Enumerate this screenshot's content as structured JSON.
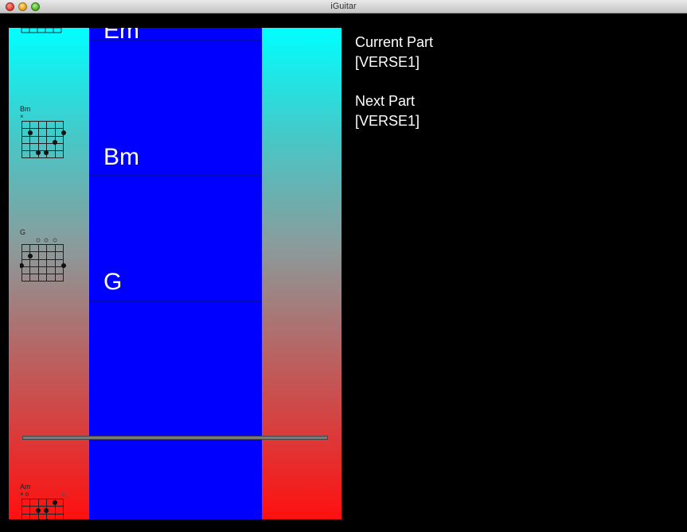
{
  "window": {
    "title": "iGuitar"
  },
  "info": {
    "current_label": "Current Part",
    "current_value": "[VERSE1]",
    "next_label": "Next Part",
    "next_value": "[VERSE1]"
  },
  "track": {
    "chords": [
      {
        "name": "Em"
      },
      {
        "name": "Bm"
      },
      {
        "name": "G"
      }
    ]
  },
  "chord_diagrams": [
    {
      "name": "Bm",
      "marks": "x"
    },
    {
      "name": "G",
      "marks": "o o o"
    },
    {
      "name": "Am",
      "marks": "x o"
    }
  ],
  "colors": {
    "track": "#0000ff",
    "gradient_top": "#00ffff",
    "gradient_bottom": "#ff1010",
    "background": "#000000"
  }
}
